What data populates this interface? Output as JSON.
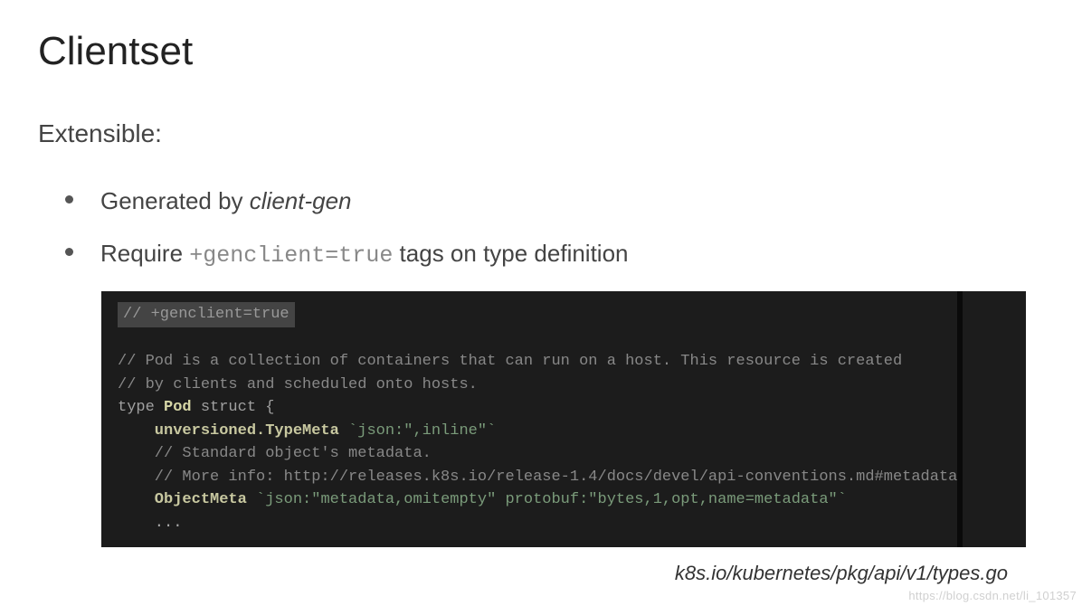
{
  "title": "Clientset",
  "subtitle": "Extensible:",
  "bullets": [
    {
      "prefix": "Generated by ",
      "italic": "client-gen",
      "suffix": ""
    },
    {
      "prefix": "Require ",
      "code": "+genclient=true",
      "suffix": " tags on type definition"
    }
  ],
  "code": {
    "highlight": "// +genclient=true",
    "line_blank": "",
    "line_c1": "// Pod is a collection of containers that can run on a host. This resource is created",
    "line_c2": "// by clients and scheduled onto hosts.",
    "line_type_kw": "type ",
    "line_type_name": "Pod",
    "line_type_struct": " struct {",
    "line_f1_name": "    unversioned.TypeMeta",
    "line_f1_tag": " `json:\",inline\"`",
    "line_c3": "    // Standard object's metadata.",
    "line_c4": "    // More info: http://releases.k8s.io/release-1.4/docs/devel/api-conventions.md#metadata",
    "line_f2_name": "    ObjectMeta",
    "line_f2_tag": " `json:\"metadata,omitempty\" protobuf:\"bytes,1,opt,name=metadata\"`",
    "line_dots": "    ..."
  },
  "source_path": "k8s.io/kubernetes/pkg/api/v1/types.go",
  "watermark": "https://blog.csdn.net/li_101357"
}
